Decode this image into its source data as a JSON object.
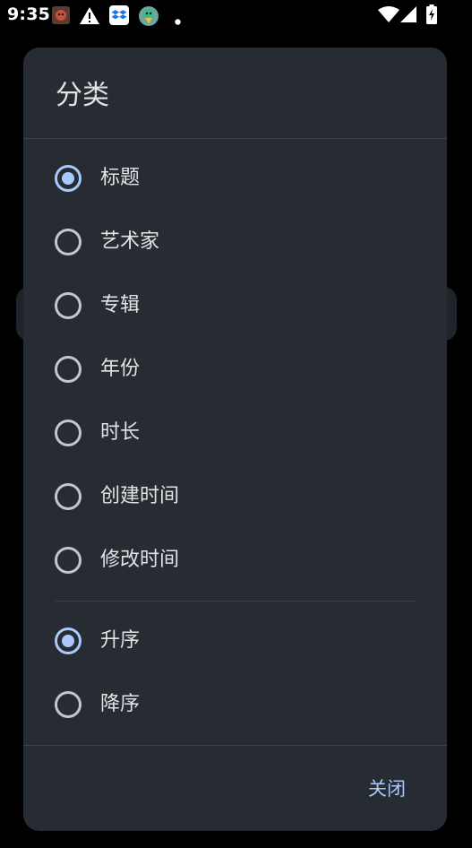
{
  "status_bar": {
    "time": "9:35",
    "icons": [
      "app-icon-red",
      "warning-icon",
      "dropbox-icon",
      "bird-app-icon",
      "dot-icon",
      "wifi-icon",
      "signal-icon",
      "battery-charging-icon"
    ]
  },
  "dialog": {
    "title": "分类",
    "sort_fields": [
      {
        "label": "标题",
        "checked": true
      },
      {
        "label": "艺术家",
        "checked": false
      },
      {
        "label": "专辑",
        "checked": false
      },
      {
        "label": "年份",
        "checked": false
      },
      {
        "label": "时长",
        "checked": false
      },
      {
        "label": "创建时间",
        "checked": false
      },
      {
        "label": "修改时间",
        "checked": false
      }
    ],
    "sort_order": [
      {
        "label": "升序",
        "checked": true
      },
      {
        "label": "降序",
        "checked": false
      }
    ],
    "close_label": "关闭"
  },
  "colors": {
    "dialog_bg": "#272b32",
    "accent": "#a9c8fc",
    "text": "#e3e3e6",
    "radio_unchecked": "#c5c6cc"
  }
}
